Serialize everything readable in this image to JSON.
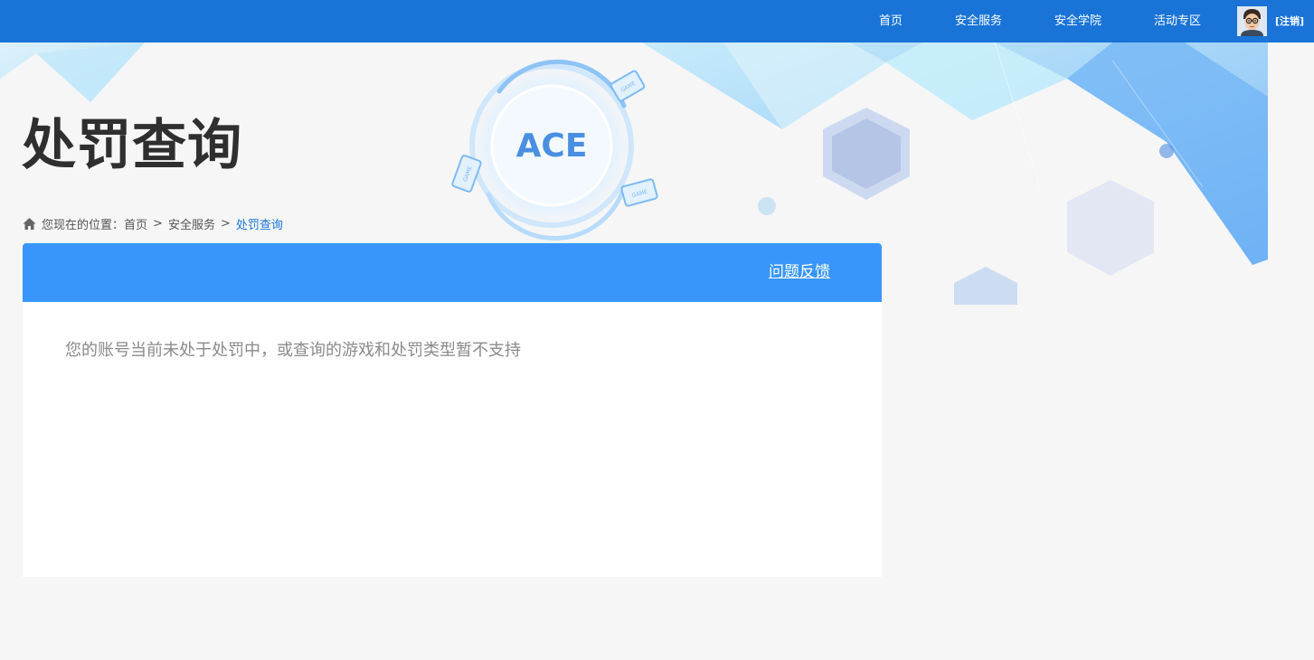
{
  "nav": {
    "items": [
      {
        "label": "首页"
      },
      {
        "label": "安全服务"
      },
      {
        "label": "安全学院"
      },
      {
        "label": "活动专区"
      }
    ],
    "logout_label": "[注销]",
    "avatar_icon": "user-avatar"
  },
  "banner": {
    "logo_text": "ACE",
    "badge_text": "GAME"
  },
  "page": {
    "title": "处罚查询"
  },
  "breadcrumb": {
    "prefix": "您现在的位置：",
    "items": [
      "首页",
      "安全服务",
      "处罚查询"
    ],
    "separator": ">",
    "icon": "home-icon"
  },
  "card": {
    "feedback_label": "问题反馈",
    "message": "您的账号当前未处于处罚中，或查询的游戏和处罚类型暂不支持"
  },
  "colors": {
    "topbar": "#1a74d8",
    "card_header": "#3896fb",
    "breadcrumb_active": "#1a74d8",
    "page_bg": "#f6f6f6"
  }
}
